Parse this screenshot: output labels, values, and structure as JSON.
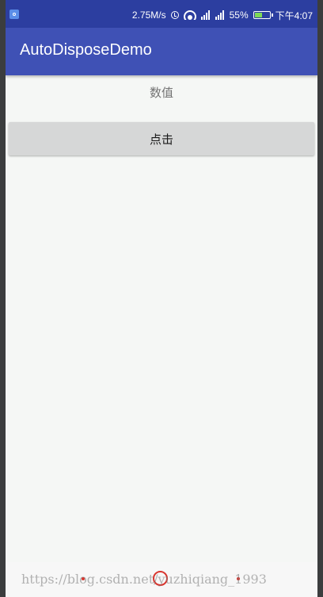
{
  "status_bar": {
    "network_speed": "2.75M/s",
    "icons": [
      "app-notification-icon",
      "alarm-icon",
      "wifi-icon",
      "signal-icon",
      "signal-icon",
      "battery-icon"
    ],
    "battery_percent": "55%",
    "battery_level": 0.55,
    "time": "下午4:07",
    "colors": {
      "background": "#2c3ea0",
      "battery_fill": "#7ed957"
    }
  },
  "app_bar": {
    "title": "AutoDisposeDemo",
    "color": "#3f51b5"
  },
  "main": {
    "value_label": "数值",
    "button_label": "点击"
  },
  "nav_bar": {
    "icons": [
      "back-icon",
      "home-icon",
      "recents-icon"
    ],
    "accent": "#d9362f"
  },
  "watermark": "https://blog.csdn.net/yuzhiqiang_1993"
}
